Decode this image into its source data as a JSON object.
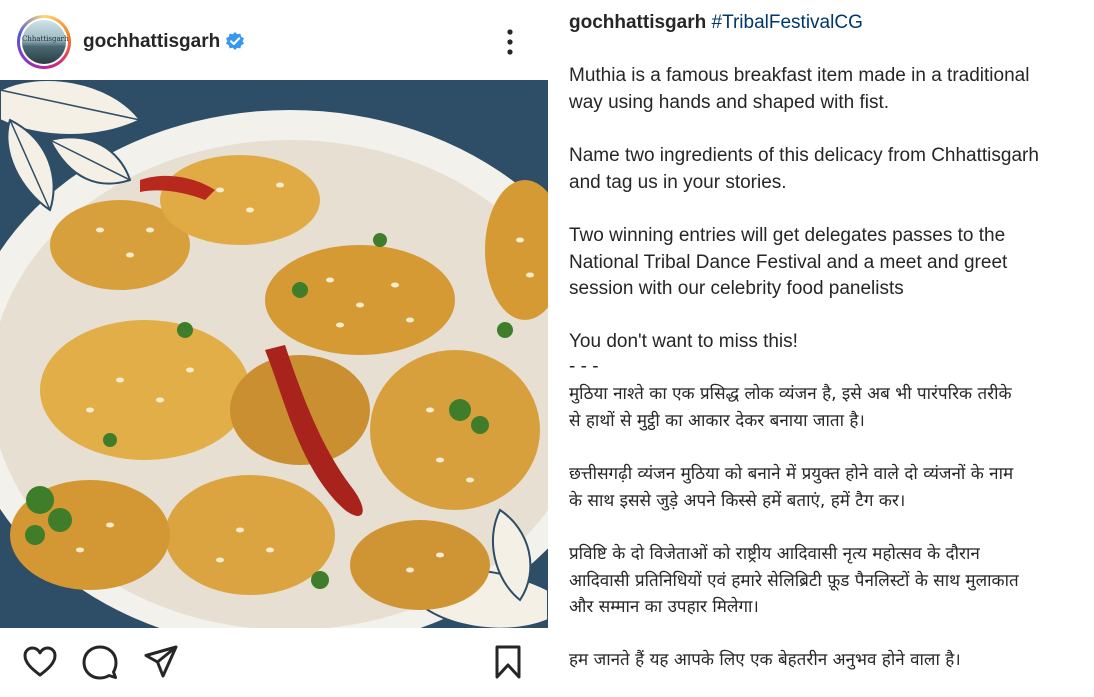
{
  "account": {
    "username": "gochhattisgarh",
    "avatar_text": "Chhattisgarh",
    "verified": true
  },
  "icons": {
    "verified": "verified-badge-icon",
    "more": "more-vertical-icon",
    "like": "heart-icon",
    "comment": "comment-icon",
    "share": "send-icon",
    "save": "bookmark-icon"
  },
  "colors": {
    "verified": "#3897f0",
    "hashtag": "#00376b",
    "frame": "#2e4d66"
  },
  "caption": {
    "username": "gochhattisgarh",
    "hashtag": "#TribalFestivalCG",
    "p1_l1": "Muthia is a famous breakfast item made in a traditional",
    "p1_l2": "way using hands and shaped with fist.",
    "p2_l1": "Name two ingredients of this delicacy from Chhattisgarh",
    "p2_l2": "and tag us in your stories.",
    "p3_l1": "Two winning entries will get delegates passes to the",
    "p3_l2": "National Tribal Dance Festival and a meet and greet",
    "p3_l3": "session with our celebrity food panelists",
    "p4": "You don't want to miss this!",
    "divider": "- - -",
    "h1_l1": "मुठिया नाश्ते का एक प्रसिद्ध लोक व्यंजन है, इसे अब भी पारंपरिक तरीके",
    "h1_l2": "से हाथों से मुट्ठी का आकार देकर बनाया जाता है।",
    "h2_l1": "छत्तीसगढ़ी व्यंजन मुठिया को बनाने में प्रयुक्त होने वाले दो व्यंजनों के नाम",
    "h2_l2": "के साथ इससे जुड़े अपने किस्से हमें बताएं, हमें टैग कर।",
    "h3_l1": "प्रविष्टि के दो विजेताओं को राष्ट्रीय आदिवासी नृत्य महोत्सव के दौरान",
    "h3_l2": "आदिवासी प्रतिनिधियों एवं हमारे सेलिब्रिटी फ़ूड पैनलिस्टों के साथ मुलाकात",
    "h3_l3": "और सम्मान का उपहार मिलेगा।",
    "h4": "हम जानते हैं यह आपके लिए एक बेहतरीन अनुभव होने वाला है।"
  }
}
